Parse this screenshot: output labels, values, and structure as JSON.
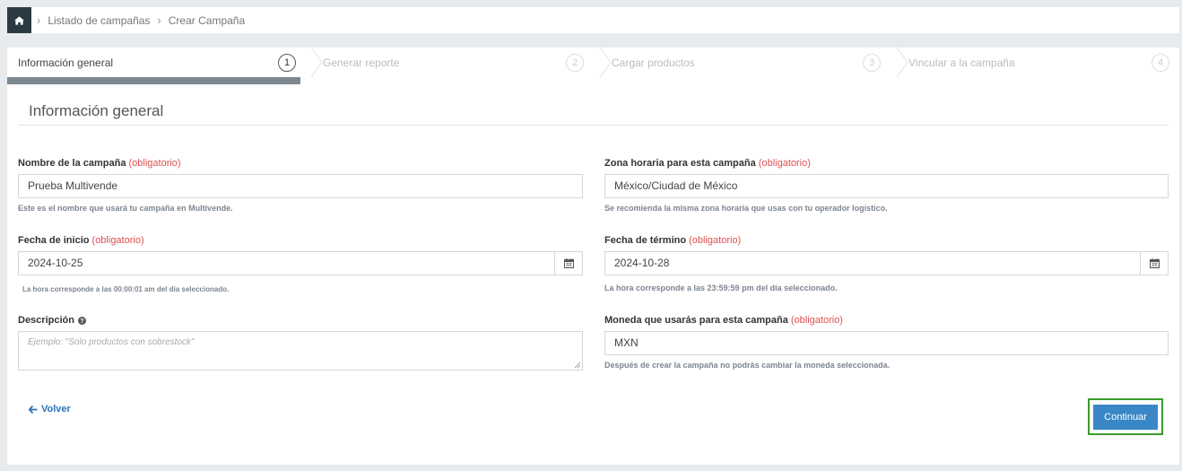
{
  "breadcrumb": {
    "items": [
      "Listado de campañas",
      "Crear Campaña"
    ]
  },
  "steps": [
    {
      "label": "Información general",
      "number": "1"
    },
    {
      "label": "Generar reporte",
      "number": "2"
    },
    {
      "label": "Cargar productos",
      "number": "3"
    },
    {
      "label": "Vincular a la campaña",
      "number": "4"
    }
  ],
  "form": {
    "title": "Información general",
    "required_text": "(obligatorio)",
    "campaign_name": {
      "label": "Nombre de la campaña",
      "value": "Prueba Multivende",
      "help": "Este es el nombre que usará tu campaña en Multivende."
    },
    "timezone": {
      "label": "Zona horaria para esta campaña",
      "value": "México/Ciudad de México",
      "help": "Se recomienda la misma zona horaria que usas con tu operador logístico."
    },
    "start_date": {
      "label": "Fecha de inicio",
      "value": "2024-10-25",
      "help": "La hora corresponde a las 00:00:01 am del día seleccionado."
    },
    "end_date": {
      "label": "Fecha de término",
      "value": "2024-10-28",
      "help": "La hora corresponde a las 23:59:59 pm del día seleccionado."
    },
    "description": {
      "label": "Descripción",
      "placeholder": "Ejemplo: \"Solo productos con sobrestock\""
    },
    "currency": {
      "label": "Moneda que usarás para esta campaña",
      "value": "MXN",
      "help": "Después de crear la campaña no podrás cambiar la moneda seleccionada."
    }
  },
  "actions": {
    "back_label": "Volver",
    "continue_label": "Continuar"
  },
  "colors": {
    "accent": "#3a87c8",
    "required": "#e05050",
    "highlight_border": "#3c9a2e",
    "home_bg": "#2b3a42"
  }
}
